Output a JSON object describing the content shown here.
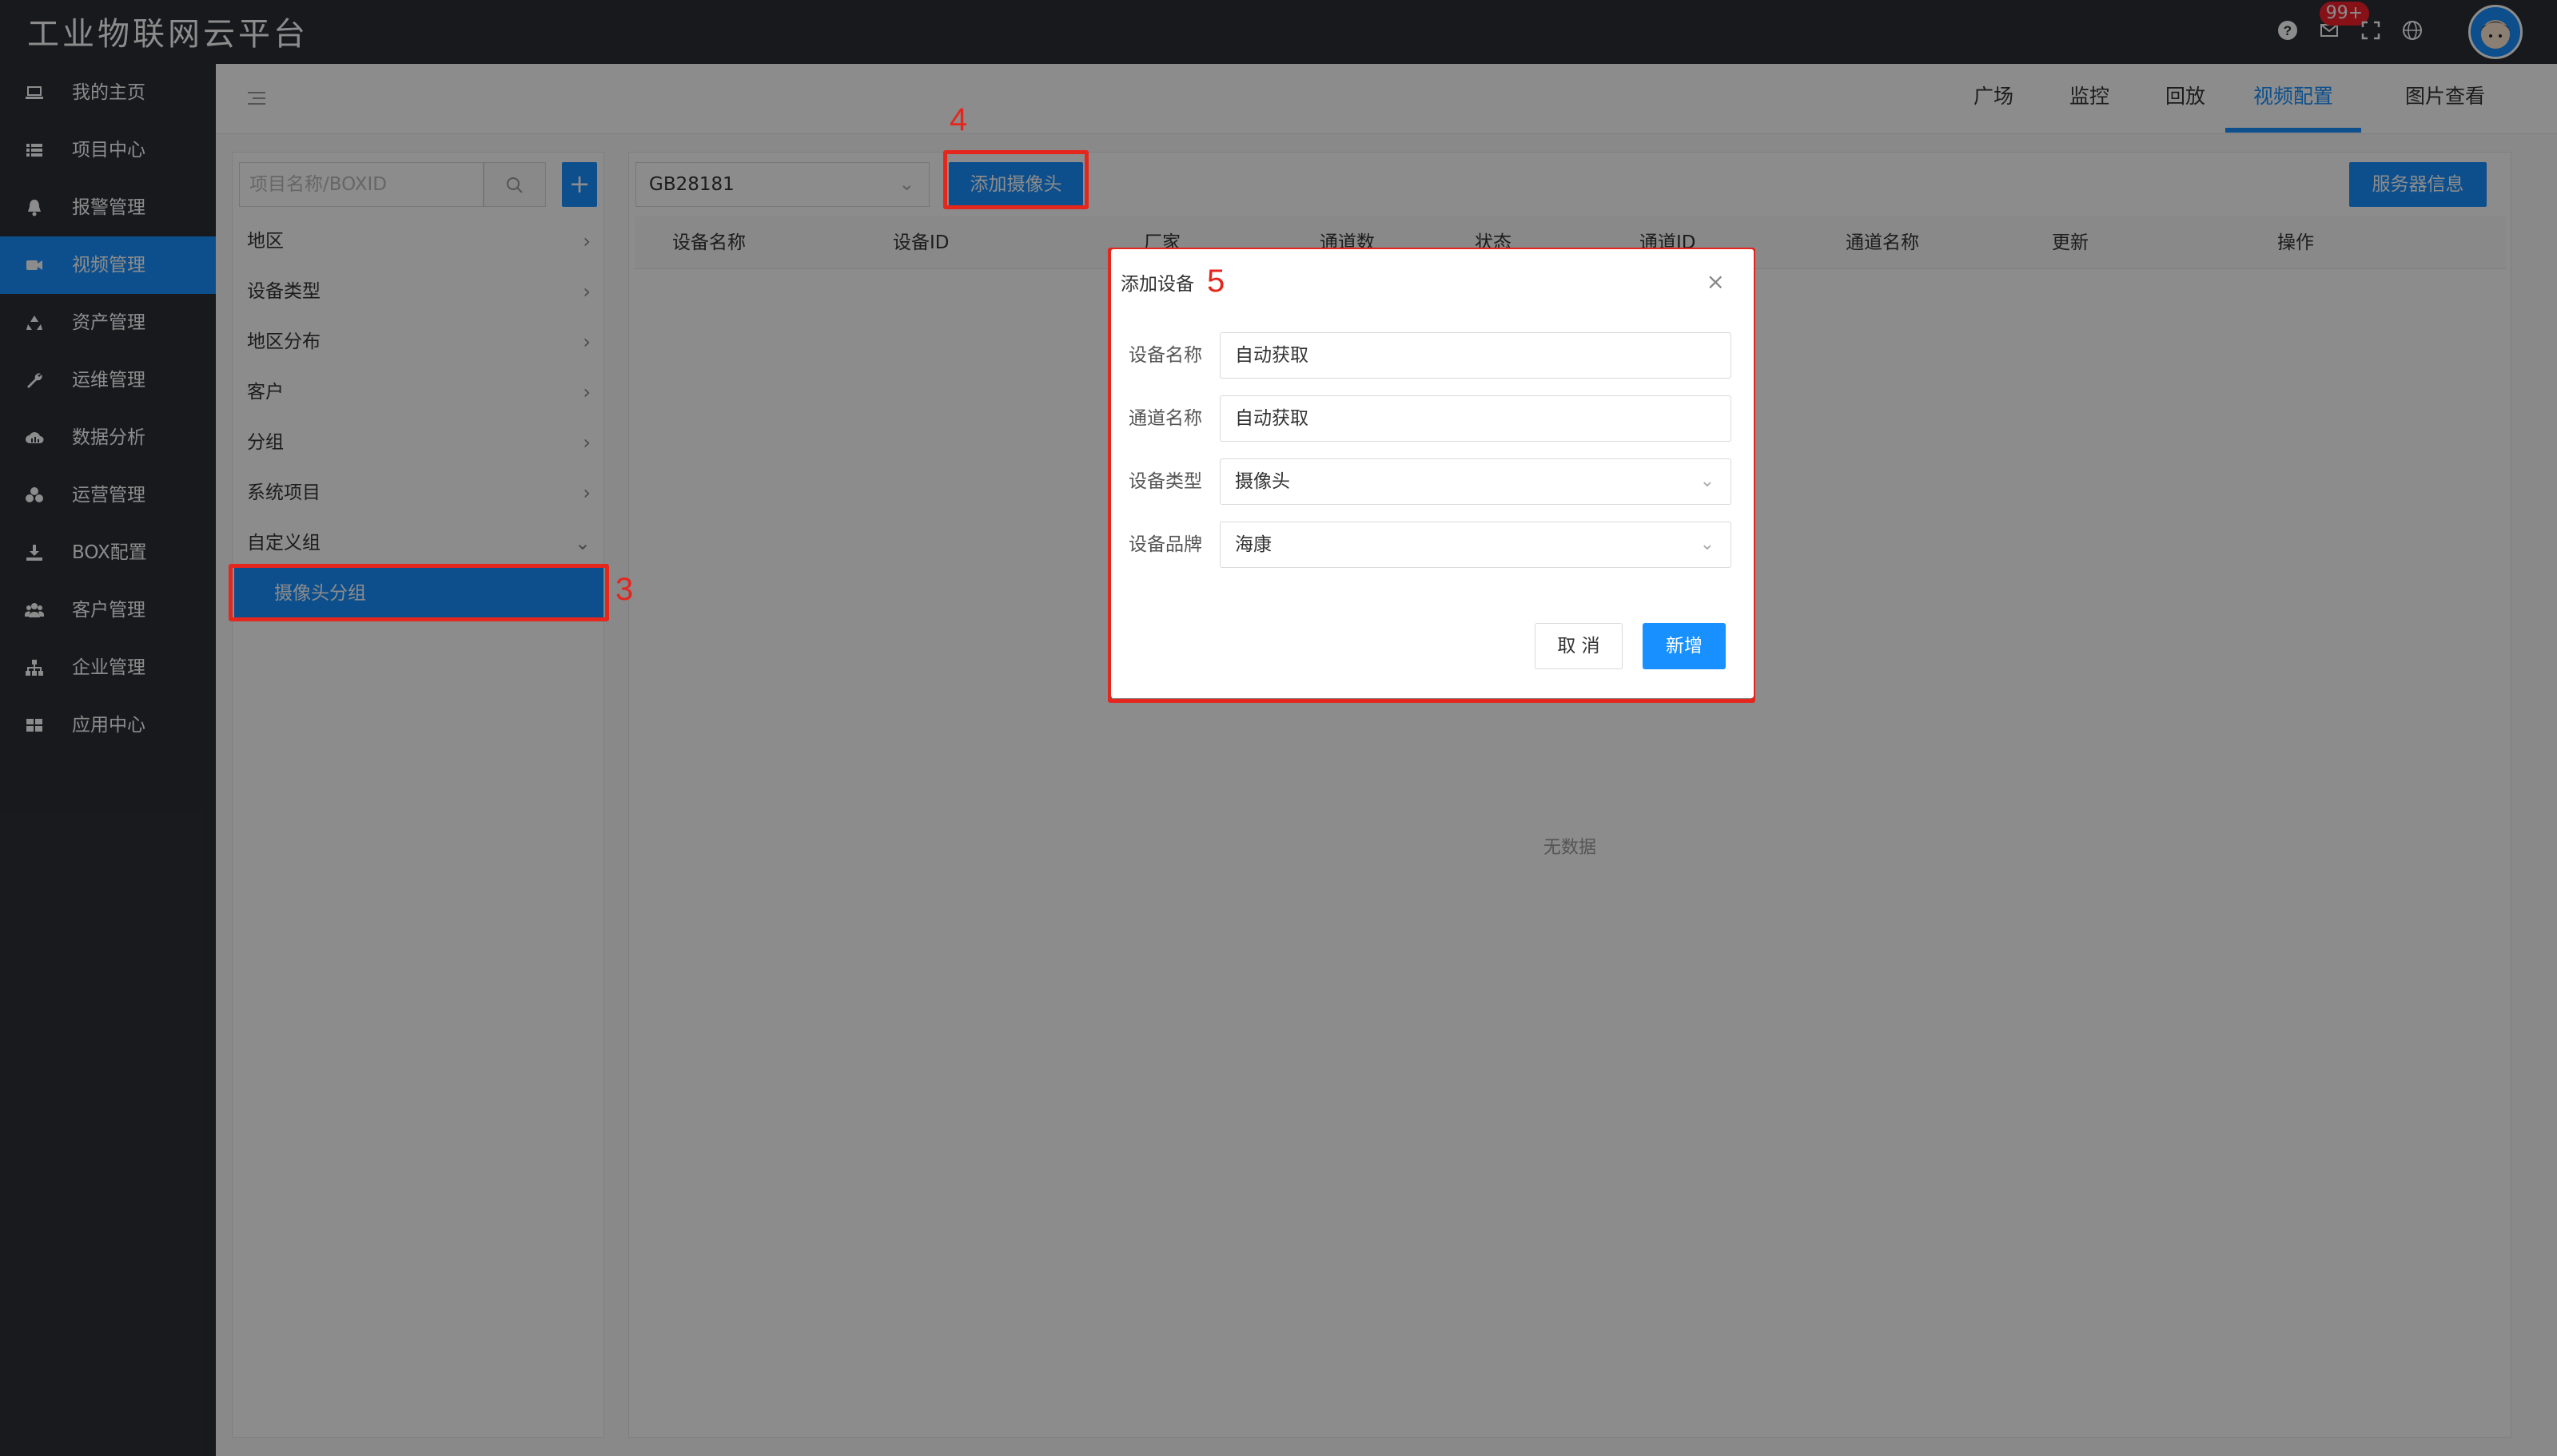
{
  "app": {
    "title": "工业物联网云平台",
    "notification_count": "99+"
  },
  "header_icons": [
    "help-icon",
    "mail-icon",
    "fullscreen-icon",
    "language-icon"
  ],
  "sidebar": {
    "items": [
      {
        "label": "我的主页",
        "icon": "laptop-icon"
      },
      {
        "label": "项目中心",
        "icon": "list-icon"
      },
      {
        "label": "报警管理",
        "icon": "bell-icon"
      },
      {
        "label": "视频管理",
        "icon": "video-icon",
        "active": true
      },
      {
        "label": "资产管理",
        "icon": "recycle-icon"
      },
      {
        "label": "运维管理",
        "icon": "wrench-icon"
      },
      {
        "label": "数据分析",
        "icon": "cloud-chart-icon"
      },
      {
        "label": "运营管理",
        "icon": "cubes-icon"
      },
      {
        "label": "BOX配置",
        "icon": "download-icon"
      },
      {
        "label": "客户管理",
        "icon": "users-icon"
      },
      {
        "label": "企业管理",
        "icon": "sitemap-icon"
      },
      {
        "label": "应用中心",
        "icon": "grid-icon"
      }
    ]
  },
  "topnav": {
    "tabs": [
      {
        "label": "广场"
      },
      {
        "label": "监控"
      },
      {
        "label": "回放"
      },
      {
        "label": "视频配置",
        "active": true
      },
      {
        "label": "图片查看"
      }
    ]
  },
  "left_panel": {
    "search_placeholder": "项目名称/BOXID",
    "add_label": "+",
    "tree": [
      {
        "label": "地区"
      },
      {
        "label": "设备类型"
      },
      {
        "label": "地区分布"
      },
      {
        "label": "客户"
      },
      {
        "label": "分组"
      },
      {
        "label": "系统项目"
      },
      {
        "label": "自定义组",
        "expanded": true
      }
    ],
    "selected_sub": "摄像头分组"
  },
  "right_panel": {
    "protocol": "GB28181",
    "add_camera_label": "添加摄像头",
    "server_info_label": "服务器信息",
    "columns": [
      "设备名称",
      "设备ID",
      "厂家",
      "通道数",
      "状态",
      "通道ID",
      "通道名称",
      "更新",
      "操作"
    ],
    "empty_text": "无数据"
  },
  "annotations": {
    "step3": "3",
    "step4": "4",
    "step5": "5",
    "color": "#e5261d"
  },
  "modal": {
    "title": "添加设备",
    "fields": [
      {
        "label": "设备名称",
        "value": "自动获取"
      },
      {
        "label": "通道名称",
        "value": "自动获取"
      },
      {
        "label": "设备类型",
        "value": "摄像头"
      },
      {
        "label": "设备品牌",
        "value": "海康"
      }
    ],
    "cancel_label": "取 消",
    "submit_label": "新增"
  },
  "colors": {
    "primary": "#1890ff",
    "dark": "#2c2f36"
  }
}
